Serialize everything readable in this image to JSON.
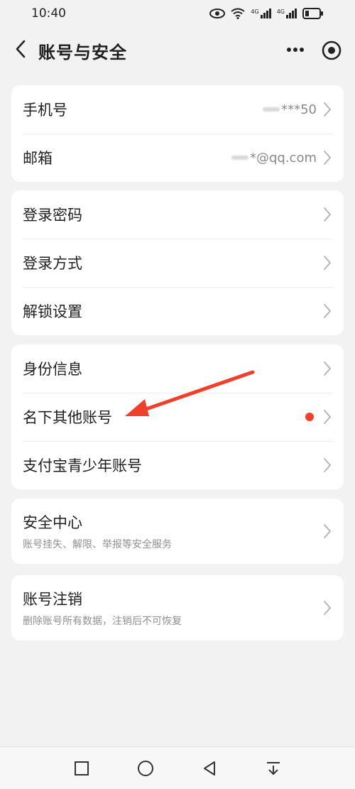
{
  "status": {
    "time": "10:40",
    "net1": "4G",
    "net2": "4G"
  },
  "header": {
    "title": "账号与安全"
  },
  "groups": [
    {
      "items": [
        {
          "label": "手机号",
          "value": "***50"
        },
        {
          "label": "邮箱",
          "value": "*@qq.com"
        }
      ]
    },
    {
      "items": [
        {
          "label": "登录密码"
        },
        {
          "label": "登录方式"
        },
        {
          "label": "解锁设置"
        }
      ]
    },
    {
      "items": [
        {
          "label": "身份信息"
        },
        {
          "label": "名下其他账号"
        },
        {
          "label": "支付宝青少年账号"
        }
      ]
    },
    {
      "items": [
        {
          "label": "安全中心",
          "sub": "账号挂失、解限、举报等安全服务"
        }
      ]
    },
    {
      "items": [
        {
          "label": "账号注销",
          "sub": "删除账号所有数据，注销后不可恢复"
        }
      ]
    }
  ],
  "colors": {
    "badge": "#f0402b",
    "annotation_arrow": "#f0402b"
  }
}
